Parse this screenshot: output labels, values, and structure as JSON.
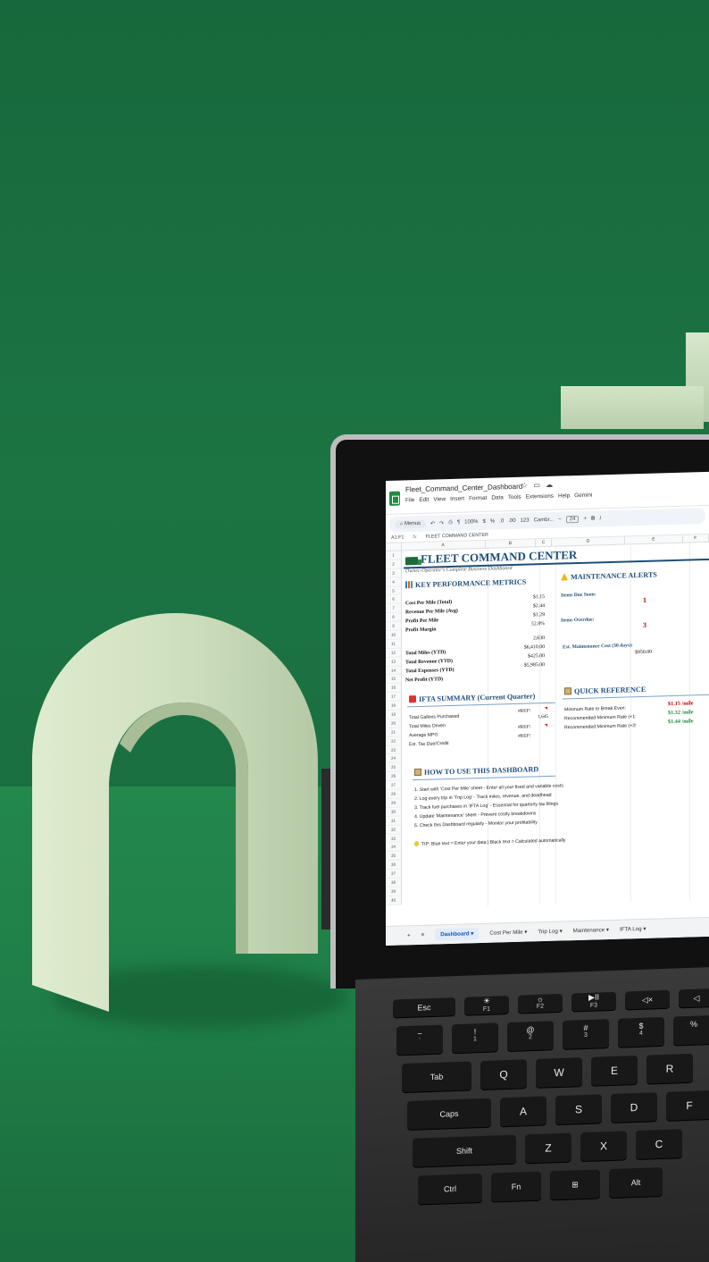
{
  "app": {
    "doc_title": "Fleet_Command_Center_Dashboard",
    "menus": [
      "File",
      "Edit",
      "View",
      "Insert",
      "Format",
      "Data",
      "Tools",
      "Extensions",
      "Help",
      "Gemini"
    ],
    "toolbar": {
      "search": "Menus",
      "zoom": "100%",
      "currency": "$",
      "percent": "%",
      "dec_decrease": ".0",
      "dec_increase": ".00",
      "number_format": "123",
      "font": "Cambr...",
      "font_size": "24",
      "bold": "B",
      "italic": "I"
    },
    "name_box": "A1:F1",
    "formula": "FLEET COMMAND CENTER",
    "columns": [
      "A",
      "B",
      "C",
      "D",
      "E",
      "F"
    ]
  },
  "sheet": {
    "title": "FLEET COMMAND CENTER",
    "subtitle": "Owner-Operator's Complete Business Dashboard",
    "kpi": {
      "heading": "KEY PERFORMANCE METRICS",
      "rows": [
        {
          "label": "Cost Per Mile (Total)",
          "value": "$1.15"
        },
        {
          "label": "Revenue Per Mile (Avg)",
          "value": "$2.44"
        },
        {
          "label": "Profit Per Mile",
          "value": "$1.29"
        },
        {
          "label": "Profit Margin",
          "value": "52.8%"
        }
      ],
      "ytd": [
        {
          "label": "Total Miles (YTD)",
          "value": "2,630"
        },
        {
          "label": "Total Revenue (YTD)",
          "value": "$6,410.00"
        },
        {
          "label": "Total Expenses (YTD)",
          "value": "$425.00"
        },
        {
          "label": "Net Profit (YTD)",
          "value": "$5,985.00"
        }
      ]
    },
    "maintenance": {
      "heading": "MAINTENANCE ALERTS",
      "due_soon_label": "Items Due Soon:",
      "due_soon_value": "1",
      "overdue_label": "Items Overdue:",
      "overdue_value": "3",
      "est_cost_label": "Est. Maintenance Cost (30 days):",
      "est_cost_value": "$950.00"
    },
    "ifta": {
      "heading": "IFTA SUMMARY (Current Quarter)",
      "rows": [
        {
          "label": "Total Gallons Purchased",
          "value": "#REF!"
        },
        {
          "label": "Total Miles Driven",
          "value": "1,645"
        },
        {
          "label": "Average MPG",
          "value": "#REF!"
        },
        {
          "label": "Est. Tax Due/Credit",
          "value": "#REF!"
        }
      ]
    },
    "quick_ref": {
      "heading": "QUICK REFERENCE",
      "rows": [
        {
          "label": "Minimum Rate to Break Even:",
          "value": "$1.15 /mile",
          "tone": "red"
        },
        {
          "label": "Recommended Minimum Rate (+1:",
          "value": "$1.32 /mile",
          "tone": "green"
        },
        {
          "label": "Recommended Minimum Rate (+2!",
          "value": "$1.44 /mile",
          "tone": "green"
        }
      ]
    },
    "howto": {
      "heading": "HOW TO USE THIS DASHBOARD",
      "steps": [
        "1. Start with 'Cost Per Mile' sheet - Enter all your fixed and variable costs",
        "2. Log every trip in 'Trip Log' - Track miles, revenue, and deadhead",
        "3. Track fuel purchases in 'IFTA Log' - Essential for quarterly tax filings",
        "4. Update 'Maintenance' sheet - Prevent costly breakdowns",
        "5. Check this Dashboard regularly - Monitor your profitability"
      ],
      "tip": "TIP: Blue text = Enter your data | Black text = Calculated automatically"
    },
    "row_count": 40
  },
  "tabs": {
    "add": "+",
    "list": "≡",
    "items": [
      "Dashboard",
      "Cost Per Mile",
      "Trip Log",
      "Maintenance",
      "IFTA Log"
    ],
    "active": "Dashboard"
  },
  "keyboard": {
    "row1": [
      {
        "main": "Esc",
        "sub": ""
      },
      {
        "main": "☀",
        "sub": "F1"
      },
      {
        "main": "☼",
        "sub": "F2"
      },
      {
        "main": "▶II",
        "sub": "F3"
      },
      {
        "main": "◁×",
        "sub": ""
      },
      {
        "main": "◁",
        "sub": ""
      }
    ],
    "row2": [
      {
        "main": "~",
        "sub": "`"
      },
      {
        "main": "!",
        "sub": "1"
      },
      {
        "main": "@",
        "sub": "2"
      },
      {
        "main": "#",
        "sub": "3"
      },
      {
        "main": "$",
        "sub": "4"
      },
      {
        "main": "%",
        "sub": ""
      }
    ],
    "row3": [
      "Tab",
      "Q",
      "W",
      "E",
      "R"
    ],
    "row4": [
      "Caps",
      "A",
      "S",
      "D",
      "F"
    ],
    "row5": [
      "Shift",
      "Z",
      "X",
      "C"
    ],
    "row6": [
      "Ctrl",
      "Fn",
      "⊞",
      "Alt"
    ]
  },
  "colors": {
    "accent_blue": "#1f4e79",
    "alert_red": "#c00000",
    "rate_green": "#1e8a36",
    "background_green": "#1f7a45"
  }
}
